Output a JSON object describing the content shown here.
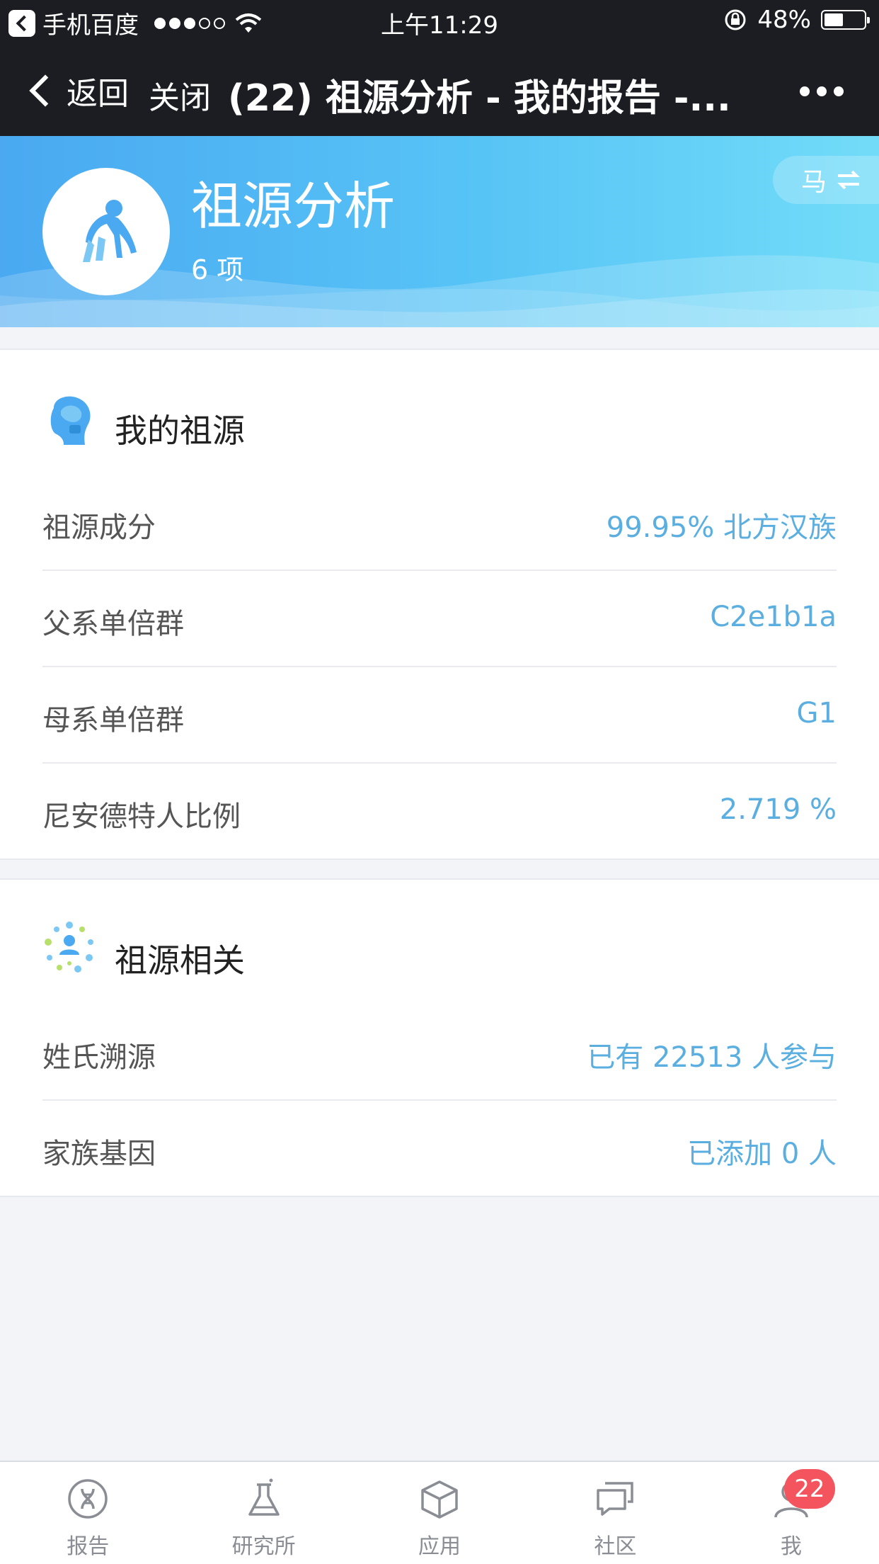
{
  "status_bar": {
    "carrier": "手机百度",
    "time": "上午11:29",
    "battery": "48%",
    "battery_level": 0.48
  },
  "nav": {
    "back_label": "返回",
    "close_label": "关闭",
    "title": "(22) 祖源分析 - 我的报告 -..."
  },
  "header": {
    "title": "祖源分析",
    "count": "6 项",
    "switch_label": "马"
  },
  "my_ancestry": {
    "title": "我的祖源",
    "rows": [
      {
        "label": "祖源成分",
        "value": "99.95% 北方汉族"
      },
      {
        "label": "父系单倍群",
        "value": "C2e1b1a"
      },
      {
        "label": "母系单倍群",
        "value": "G1"
      },
      {
        "label": "尼安德特人比例",
        "value": "2.719 %"
      }
    ]
  },
  "related": {
    "title": "祖源相关",
    "rows": [
      {
        "label": "姓氏溯源",
        "value": "已有 22513 人参与"
      },
      {
        "label": "家族基因",
        "value": "已添加 0 人"
      }
    ]
  },
  "tabs": [
    {
      "label": "报告",
      "icon": "dna-icon"
    },
    {
      "label": "研究所",
      "icon": "flask-icon"
    },
    {
      "label": "应用",
      "icon": "cube-icon"
    },
    {
      "label": "社区",
      "icon": "chat-icon"
    },
    {
      "label": "我",
      "icon": "user-icon",
      "badge": "22"
    }
  ],
  "colors": {
    "accent": "#5aaee0",
    "badge": "#f4545d",
    "nav_bg": "#1c1d22"
  }
}
